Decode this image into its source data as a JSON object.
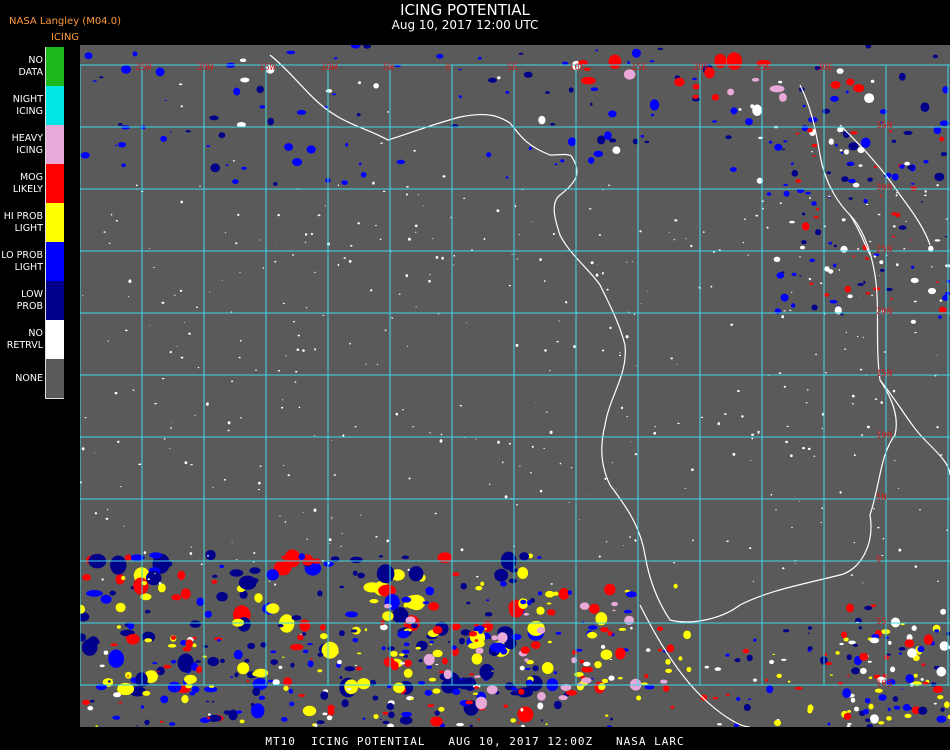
{
  "header": {
    "source": "NASA Langley (M04.0)",
    "product": "ICING",
    "title": "ICING POTENTIAL",
    "datetime": "Aug 10, 2017 12:00 UTC"
  },
  "legend": {
    "items": [
      {
        "label": "NO DATA",
        "color": "#1db81d"
      },
      {
        "label": "NIGHT ICING",
        "color": "#00e5e5"
      },
      {
        "label": "HEAVY ICING",
        "color": "#e8a8d8"
      },
      {
        "label": "MOG LIKELY",
        "color": "#ff0000"
      },
      {
        "label": "HI PROB LIGHT",
        "color": "#ffff00"
      },
      {
        "label": "LO PROB LIGHT",
        "color": "#0000ff"
      },
      {
        "label": "LOW PROB",
        "color": "#00008b"
      },
      {
        "label": "NO RETRVL",
        "color": "#ffffff"
      },
      {
        "label": "NONE",
        "color": "#5a5a5a"
      }
    ]
  },
  "map": {
    "background": "#5a5a5a",
    "grid_color": "#40d8e8",
    "coast_color": "#ffffff",
    "label_color": "#cc2222",
    "top_labels": [
      "25W",
      "20W",
      "15W",
      "10W",
      "5W",
      "0",
      "5E",
      "10E",
      "15E",
      "20E",
      "25E",
      "30E"
    ],
    "right_labels": [
      "35N",
      "30N",
      "25N",
      "20N",
      "15N",
      "10N",
      "5N",
      "0",
      "5S",
      "10S"
    ]
  },
  "footer": "MT10  ICING POTENTIAL   AUG 10, 2017 12:00Z   NASA LARC"
}
